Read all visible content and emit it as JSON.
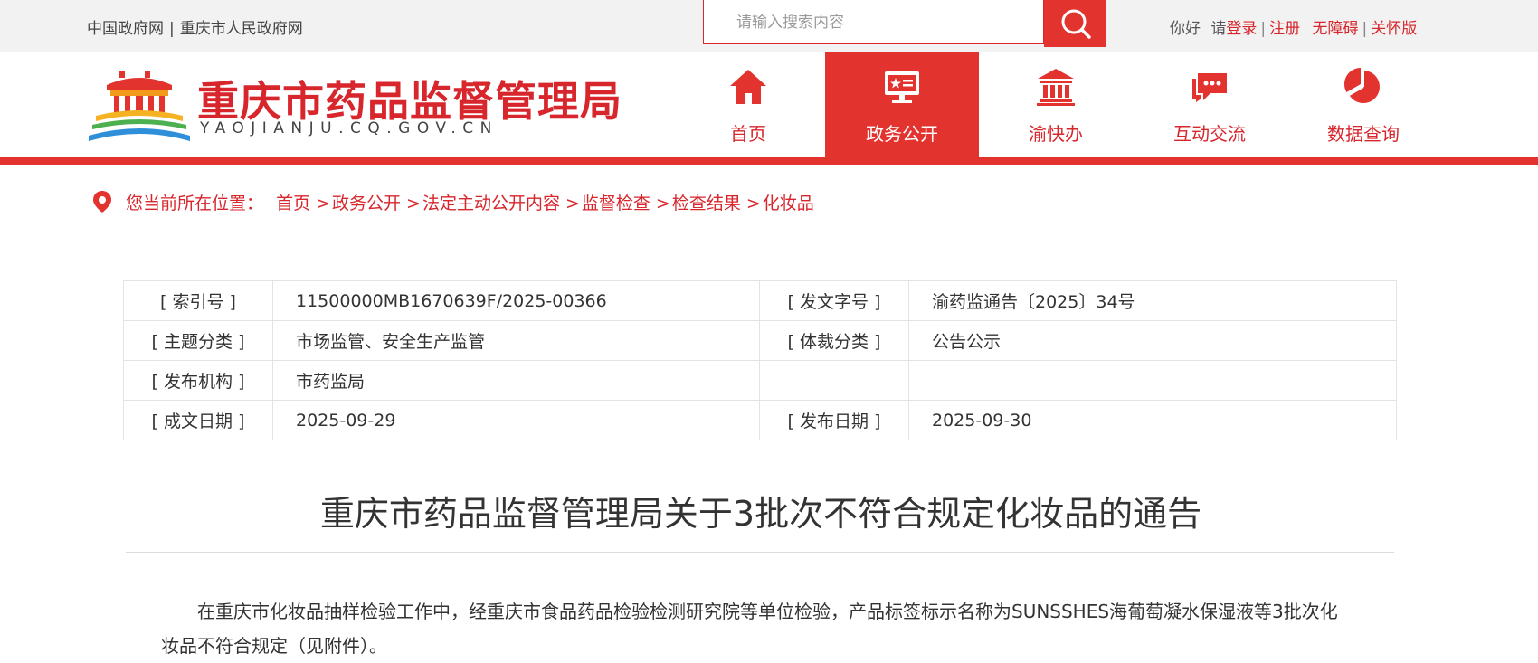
{
  "topbar": {
    "links": [
      "中国政府网",
      "重庆市人民政府网"
    ],
    "separator": "|",
    "search_placeholder": "请输入搜索内容",
    "greeting": "你好",
    "please": "请",
    "login": "登录",
    "register": "注册",
    "accessibility": "无障碍",
    "care_mode": "关怀版"
  },
  "header": {
    "site_title": "重庆市药品监督管理局",
    "site_domain": "YAOJIANJU.CQ.GOV.CN"
  },
  "nav": [
    {
      "label": "首页",
      "icon": "home-icon",
      "active": false
    },
    {
      "label": "政务公开",
      "icon": "monitor-star-icon",
      "active": true
    },
    {
      "label": "渝快办",
      "icon": "government-building-icon",
      "active": false
    },
    {
      "label": "互动交流",
      "icon": "chat-bubble-icon",
      "active": false
    },
    {
      "label": "数据查询",
      "icon": "pie-chart-icon",
      "active": false
    }
  ],
  "breadcrumb": {
    "prefix": "您当前所在位置：",
    "items": [
      "首页",
      "政务公开",
      "法定主动公开内容",
      "监督检查",
      "检查结果",
      "化妆品"
    ]
  },
  "meta": {
    "index_no_label": "[ 索引号 ]",
    "index_no": "11500000MB1670639F/2025-00366",
    "doc_no_label": "[ 发文字号 ]",
    "doc_no": "渝药监通告〔2025〕34号",
    "topic_label": "[ 主题分类 ]",
    "topic": "市场监管、安全生产监管",
    "genre_label": "[ 体裁分类 ]",
    "genre": "公告公示",
    "issuer_label": "[ 发布机构 ]",
    "issuer": "市药监局",
    "written_label": "[ 成文日期 ]",
    "written_date": "2025-09-29",
    "publish_label": "[ 发布日期 ]",
    "publish_date": "2025-09-30"
  },
  "article": {
    "title": "重庆市药品监督管理局关于3批次不符合规定化妆品的通告",
    "paragraph": "在重庆市化妆品抽样检验工作中，经重庆市食品药品检验检测研究院等单位检验，产品标签标示名称为SUNSSHES海葡萄凝水保湿液等3批次化妆品不符合规定（见附件）。"
  },
  "colors": {
    "brand_red": "#e2332f",
    "text_red": "#d7262c"
  }
}
